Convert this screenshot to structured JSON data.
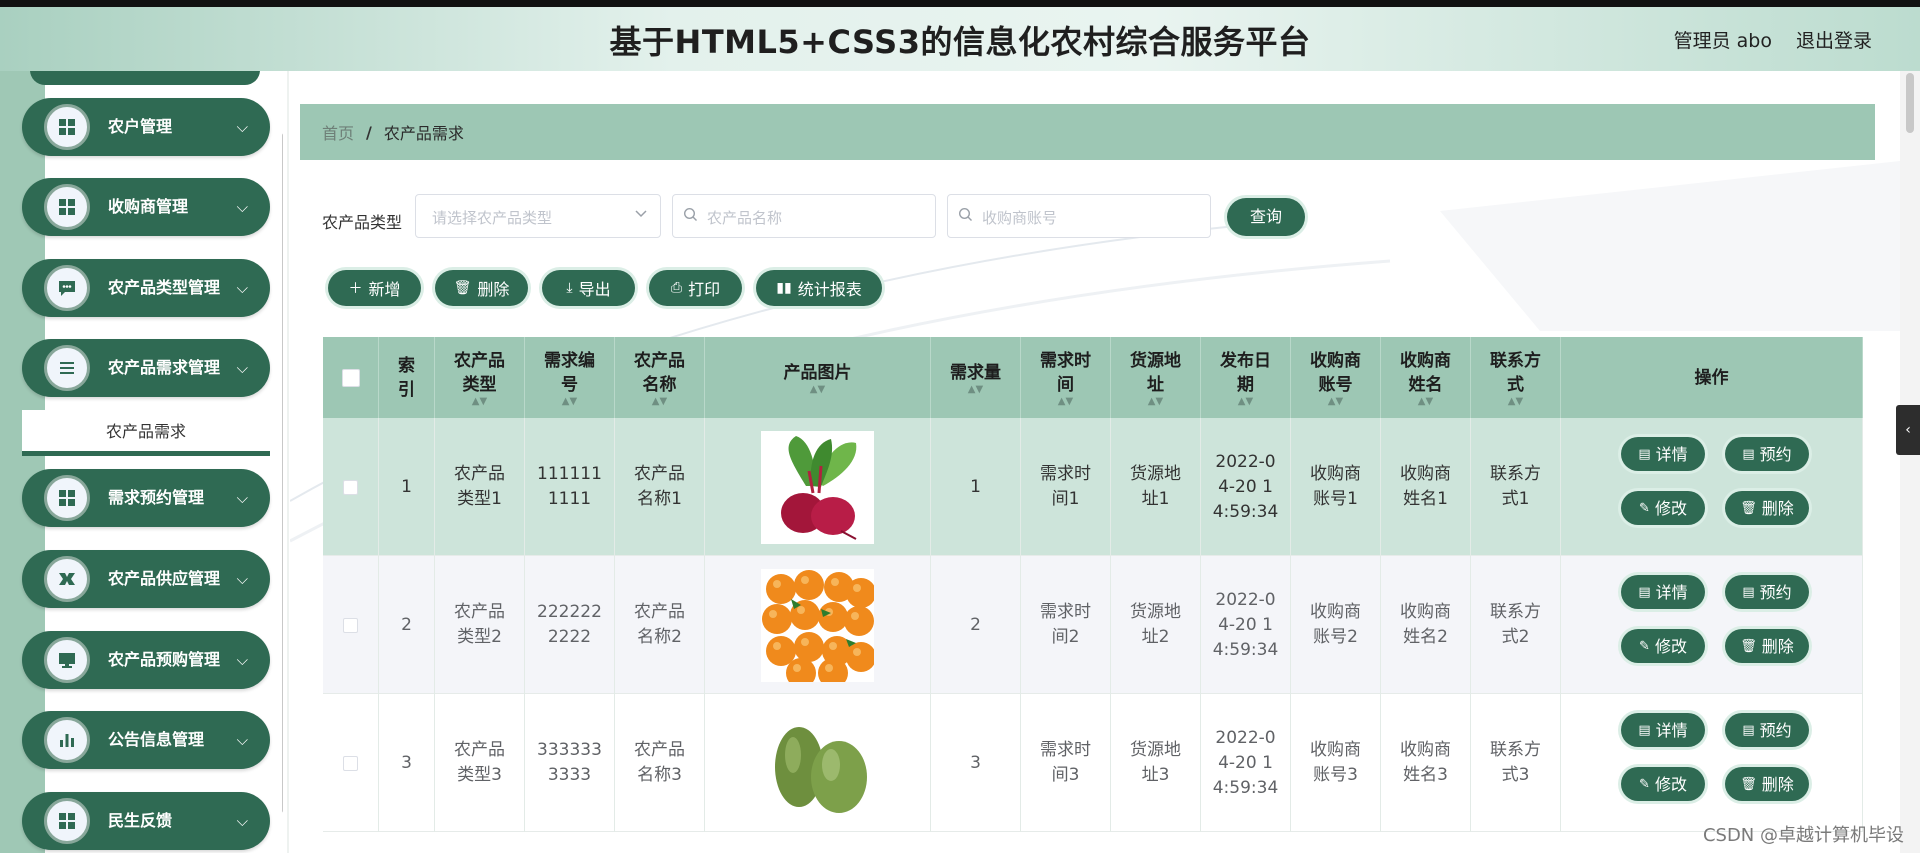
{
  "header": {
    "title": "基于HTML5+CSS3的信息化农村综合服务平台",
    "user": "管理员 abo",
    "logout": "退出登录"
  },
  "sidebar": {
    "items": [
      {
        "label": "农户管理",
        "icon": "grid-icon"
      },
      {
        "label": "收购商管理",
        "icon": "grid-icon"
      },
      {
        "label": "农产品类型管理",
        "icon": "chat-icon"
      },
      {
        "label": "农产品需求管理",
        "icon": "list-icon"
      },
      {
        "label": "需求预约管理",
        "icon": "grid-icon"
      },
      {
        "label": "农产品供应管理",
        "icon": "flag-icon"
      },
      {
        "label": "农产品预购管理",
        "icon": "monitor-icon"
      },
      {
        "label": "公告信息管理",
        "icon": "bar-chart-icon"
      },
      {
        "label": "民生反馈",
        "icon": "grid-icon"
      }
    ],
    "active_sub": "农产品需求"
  },
  "breadcrumb": {
    "home": "首页",
    "sep": "/",
    "current": "农产品需求"
  },
  "filters": {
    "type_label": "农产品类型",
    "type_placeholder": "请选择农产品类型",
    "name_placeholder": "农产品名称",
    "buyer_placeholder": "收购商账号",
    "query_label": "查询"
  },
  "toolbar": {
    "add": "新增",
    "delete": "删除",
    "export": "导出",
    "print": "打印",
    "report": "统计报表"
  },
  "table": {
    "headers": {
      "index": [
        "索",
        "引"
      ],
      "type": [
        "农产品",
        "类型"
      ],
      "code": [
        "需求编",
        "号"
      ],
      "name": [
        "农产品",
        "名称"
      ],
      "image": [
        "产品图片"
      ],
      "qty": [
        "需求量"
      ],
      "time": [
        "需求时",
        "间"
      ],
      "addr": [
        "货源地",
        "址"
      ],
      "date": [
        "发布日",
        "期"
      ],
      "buyer_acc": [
        "收购商",
        "账号"
      ],
      "buyer_name": [
        "收购商",
        "姓名"
      ],
      "contact": [
        "联系方",
        "式"
      ],
      "ops": [
        "操作"
      ]
    },
    "rows": [
      {
        "index": "1",
        "type": [
          "农产品",
          "类型1"
        ],
        "code": [
          "111111",
          "1111"
        ],
        "name": [
          "农产品",
          "名称1"
        ],
        "image": "beetroot",
        "qty": "1",
        "time": [
          "需求时",
          "间1"
        ],
        "addr": [
          "货源地",
          "址1"
        ],
        "date": [
          "2022-0",
          "4-20 1",
          "4:59:34"
        ],
        "buyer_acc": [
          "收购商",
          "账号1"
        ],
        "buyer_name": [
          "收购商",
          "姓名1"
        ],
        "contact": [
          "联系方",
          "式1"
        ]
      },
      {
        "index": "2",
        "type": [
          "农产品",
          "类型2"
        ],
        "code": [
          "222222",
          "2222"
        ],
        "name": [
          "农产品",
          "名称2"
        ],
        "image": "oranges",
        "qty": "2",
        "time": [
          "需求时",
          "间2"
        ],
        "addr": [
          "货源地",
          "址2"
        ],
        "date": [
          "2022-0",
          "4-20 1",
          "4:59:34"
        ],
        "buyer_acc": [
          "收购商",
          "账号2"
        ],
        "buyer_name": [
          "收购商",
          "姓名2"
        ],
        "contact": [
          "联系方",
          "式2"
        ]
      },
      {
        "index": "3",
        "type": [
          "农产品",
          "类型3"
        ],
        "code": [
          "333333",
          "3333"
        ],
        "name": [
          "农产品",
          "名称3"
        ],
        "image": "wax-gourd",
        "qty": "3",
        "time": [
          "需求时",
          "间3"
        ],
        "addr": [
          "货源地",
          "址3"
        ],
        "date": [
          "2022-0",
          "4-20 1",
          "4:59:34"
        ],
        "buyer_acc": [
          "收购商",
          "账号3"
        ],
        "buyer_name": [
          "收购商",
          "姓名3"
        ],
        "contact": [
          "联系方",
          "式3"
        ]
      }
    ],
    "ops": {
      "detail": "详情",
      "book": "预约",
      "edit": "修改",
      "delete": "删除"
    }
  },
  "watermark": "CSDN @卓越计算机毕设",
  "colors": {
    "primary": "#2f6a53",
    "header_bg": "#9dc7b4",
    "rail": "#9fc8b5"
  }
}
